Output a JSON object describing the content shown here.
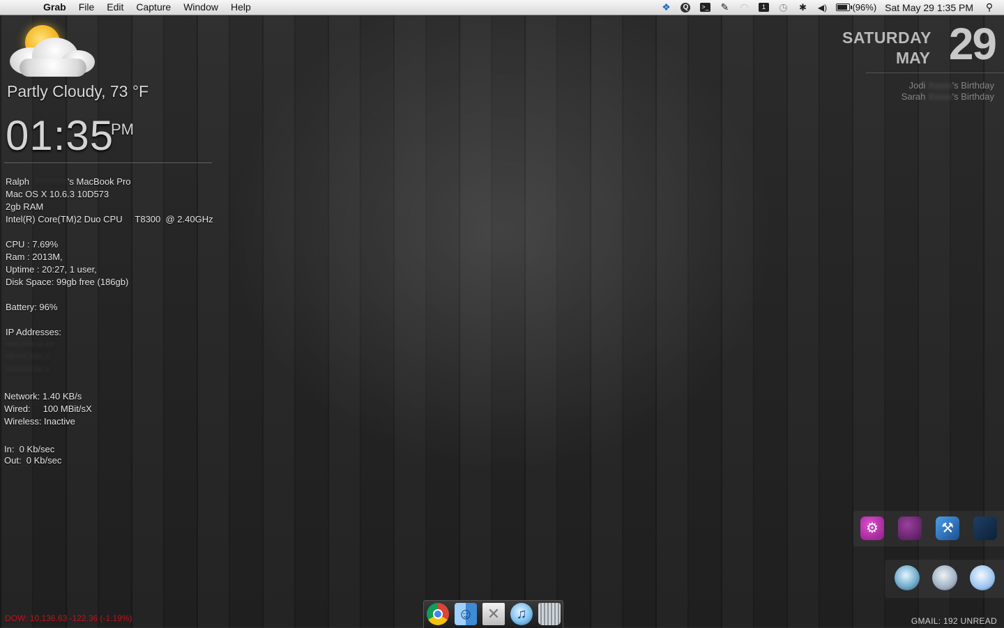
{
  "menubar": {
    "apple_icon": "apple-icon",
    "app_name": "Grab",
    "menus": [
      "File",
      "Edit",
      "Capture",
      "Window",
      "Help"
    ],
    "tray_icons": [
      "dropbox-icon",
      "quicksilver-icon",
      "terminal-icon",
      "evernote-icon",
      "wifi-icon",
      "onepassword-icon",
      "time-machine-icon",
      "bluetooth-icon",
      "volume-icon"
    ],
    "battery_percent": 96,
    "battery_label": "(96%)",
    "clock": "Sat May 29  1:35 PM",
    "spotlight_icon": "spotlight-icon"
  },
  "weather": {
    "condition": "Partly Cloudy, 73 °F",
    "icon": "partly-cloudy-icon"
  },
  "clock_widget": {
    "time": "01:35",
    "ampm": "PM"
  },
  "system": {
    "owner_first": "Ralph",
    "owner_suffix": "'s MacBook Pro",
    "os": "Mac OS X 10.6.3 10D573",
    "ram": "2gb RAM",
    "cpu_model": "Intel(R) Core(TM)2 Duo CPU     T8300  @ 2.40GHz",
    "cpu": "CPU : 7.69%",
    "ram_used": "Ram : 2013M,",
    "uptime": "Uptime : 20:27, 1 user,",
    "disk": "Disk Space:  99gb free (186gb)",
    "battery": "Battery: 96%",
    "ip_label": "IP Addresses:"
  },
  "network": {
    "speed": "Network: 1.40 KB/s",
    "wired": "Wired:     100 MBit/sX",
    "wireless": "Wireless: Inactive",
    "in": "In:  0 Kb/sec",
    "out": "Out:  0 Kb/sec"
  },
  "stocks": {
    "dow": "DOW: 10,136.63 -122.36 (-1.19%)",
    "color": "#c0121a"
  },
  "date_widget": {
    "day_name": "SATURDAY",
    "month": "MAY",
    "day_number": "29",
    "events": [
      {
        "first": "Jodi",
        "suffix": "'s Birthday"
      },
      {
        "first": "Sarah",
        "suffix": "'s Birthday"
      }
    ]
  },
  "gmail": {
    "label": "GMAIL: 192 UNREAD"
  },
  "dock": {
    "items": [
      "chrome-icon",
      "finder-icon",
      "mail-icon",
      "itunes-icon",
      "trash-icon"
    ]
  }
}
